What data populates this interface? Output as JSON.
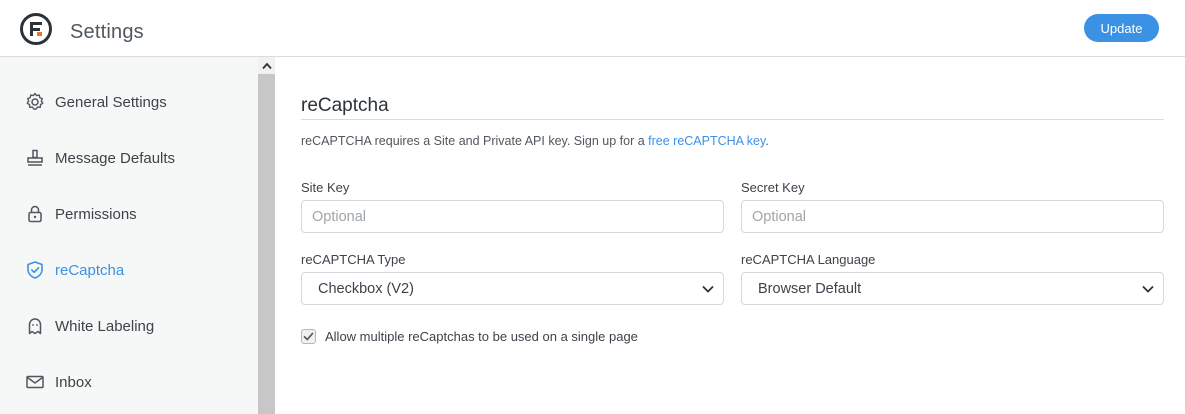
{
  "header": {
    "title": "Settings",
    "update_label": "Update"
  },
  "sidebar": {
    "items": [
      {
        "label": "General Settings",
        "icon": "gear-icon"
      },
      {
        "label": "Message Defaults",
        "icon": "stamp-icon"
      },
      {
        "label": "Permissions",
        "icon": "lock-icon"
      },
      {
        "label": "reCaptcha",
        "icon": "shield-check-icon",
        "active": true
      },
      {
        "label": "White Labeling",
        "icon": "ghost-icon"
      },
      {
        "label": "Inbox",
        "icon": "envelope-icon"
      }
    ]
  },
  "main": {
    "section_title": "reCaptcha",
    "description_prefix": "reCAPTCHA requires a Site and Private API key. Sign up for a ",
    "description_link": "free reCAPTCHA key",
    "description_suffix": ".",
    "site_key": {
      "label": "Site Key",
      "value": "",
      "placeholder": "Optional"
    },
    "secret_key": {
      "label": "Secret Key",
      "value": "",
      "placeholder": "Optional"
    },
    "captcha_type": {
      "label": "reCAPTCHA Type",
      "value": "Checkbox (V2)"
    },
    "captcha_language": {
      "label": "reCAPTCHA Language",
      "value": "Browser Default"
    },
    "multiple_checkbox": {
      "label": "Allow multiple reCaptchas to be used on a single page",
      "checked": true
    }
  },
  "colors": {
    "accent": "#3b92e4",
    "sidebar_bg": "#f6f7f7",
    "text": "#3c434a"
  }
}
